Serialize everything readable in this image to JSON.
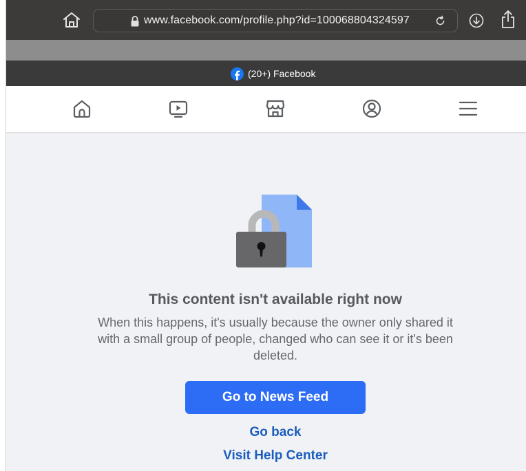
{
  "browser": {
    "url": "www.facebook.com/profile.php?id=100068804324597",
    "tab_title": "(20+) Facebook",
    "icons": {
      "home": "home-icon",
      "lock": "lock-icon",
      "reload": "reload-icon",
      "download": "download-icon",
      "share": "share-icon",
      "favicon": "facebook-favicon"
    }
  },
  "fb_nav": {
    "items": [
      {
        "icon": "home-icon"
      },
      {
        "icon": "watch-video-icon"
      },
      {
        "icon": "marketplace-icon"
      },
      {
        "icon": "profile-icon"
      },
      {
        "icon": "menu-icon"
      }
    ]
  },
  "content": {
    "title": "This content isn't available right now",
    "body": "When this happens, it's usually because the owner only shared it with a small group of people, changed who can see it or it's been deleted.",
    "primary_button": "Go to News Feed",
    "go_back_link": "Go back",
    "help_center_link": "Visit Help Center",
    "illustration": "locked-document-icon"
  },
  "colors": {
    "primary": "#2d6df5",
    "link": "#1b5dbe",
    "page_background": "#f0f2f5",
    "browser_chrome": "#3d3b39"
  }
}
